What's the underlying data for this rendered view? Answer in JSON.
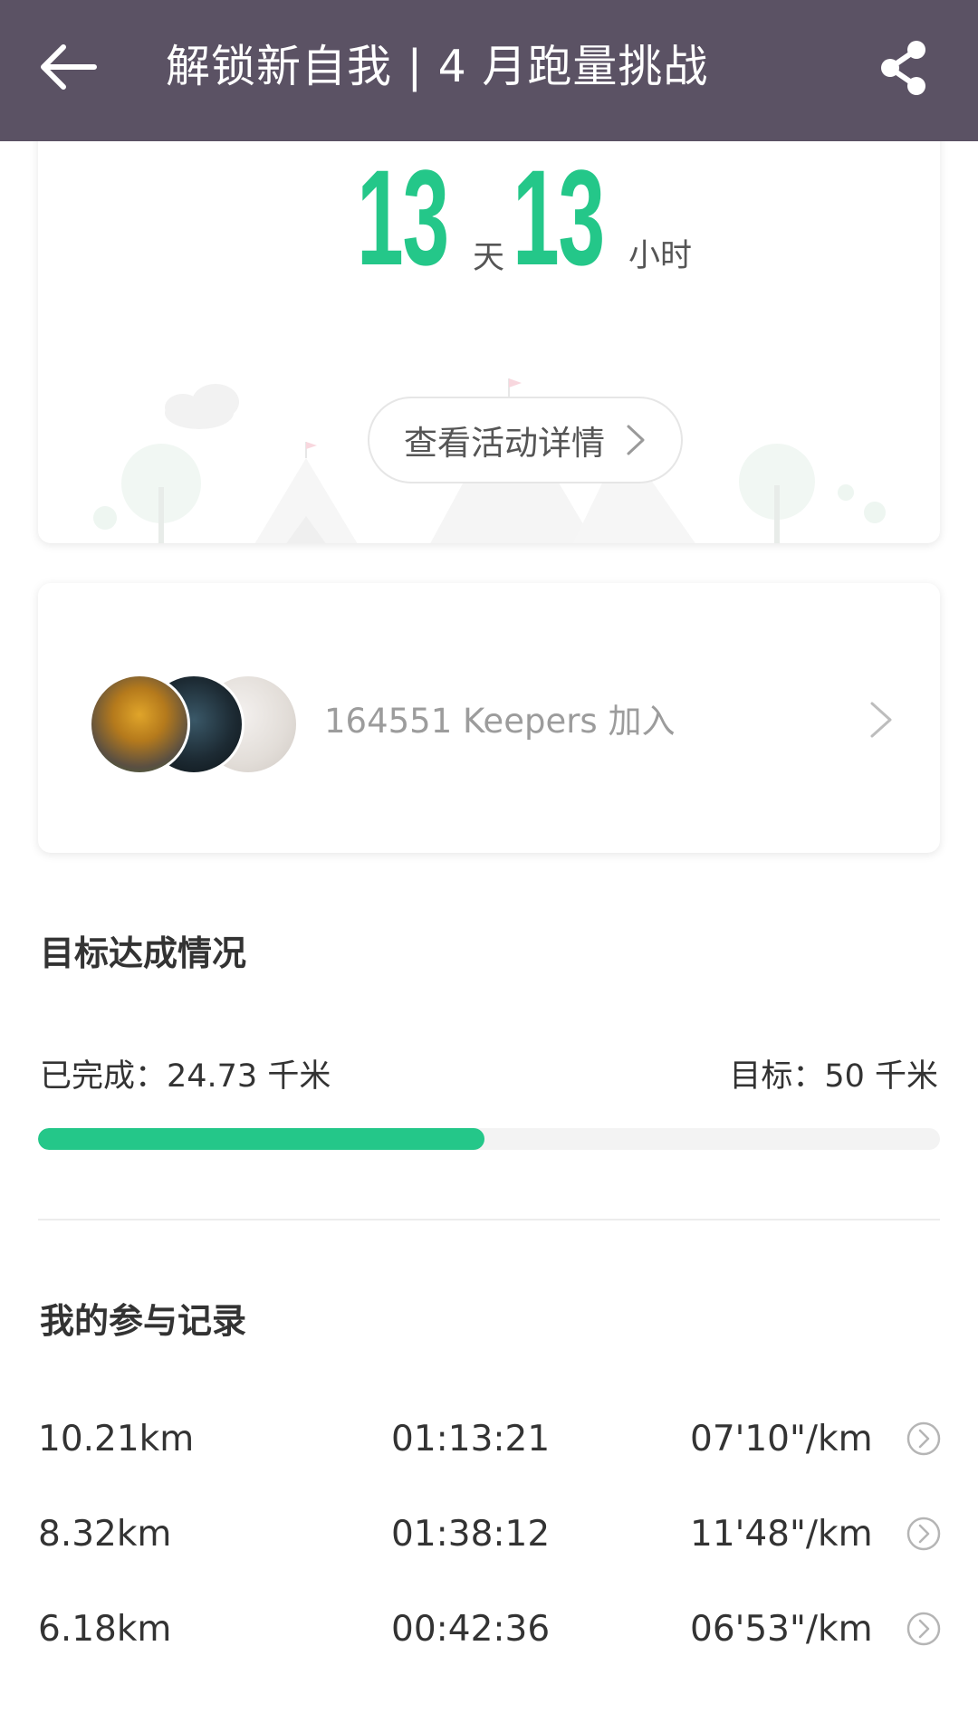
{
  "header": {
    "title": "解锁新自我 | 4 月跑量挑战"
  },
  "countdown": {
    "days": "13",
    "days_unit": "天",
    "hours": "13",
    "hours_unit": "小时",
    "detail_button": "查看活动详情"
  },
  "keepers": {
    "text": "164551 Keepers 加入"
  },
  "goal": {
    "title": "目标达成情况",
    "completed_text": "已完成：24.73 千米",
    "target_text": "目标：50 千米",
    "progress_fraction": 0.4946
  },
  "records": {
    "title": "我的参与记录",
    "rows": [
      {
        "distance": "10.21km",
        "duration": "01:13:21",
        "pace": "07'10\"/km"
      },
      {
        "distance": "8.32km",
        "duration": "01:38:12",
        "pace": "11'48\"/km"
      },
      {
        "distance": "6.18km",
        "duration": "00:42:36",
        "pace": "06'53\"/km"
      }
    ]
  },
  "colors": {
    "header_bg": "#5b5264",
    "accent_green": "#24c789",
    "progress_track": "#f3f3f3"
  },
  "icons": {
    "back": "back-arrow-icon",
    "share": "share-icon",
    "chevron": "chevron-right-icon",
    "row_arrow": "circle-chevron-right-icon"
  }
}
